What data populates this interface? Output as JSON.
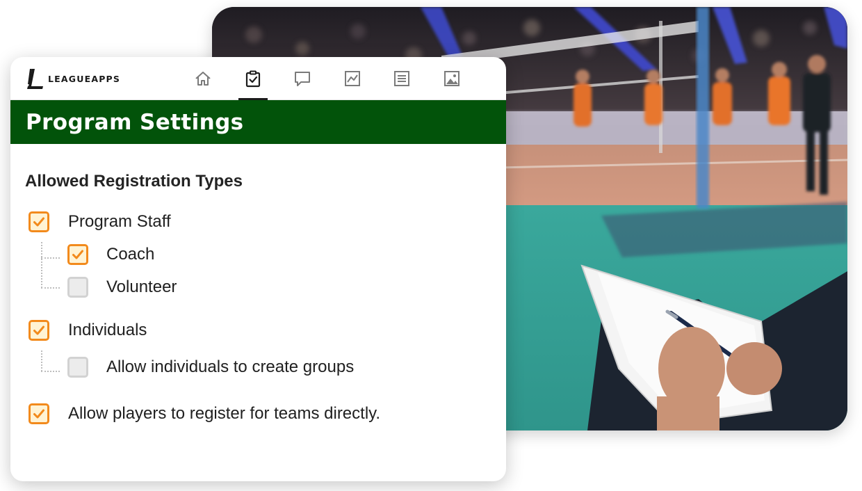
{
  "brand": {
    "logo_text": "LEAGUEAPPS",
    "accent_color": "#f28a1c",
    "header_color": "#02530a"
  },
  "nav": {
    "tabs": [
      {
        "icon": "home-icon",
        "active": false
      },
      {
        "icon": "clipboard-check-icon",
        "active": true
      },
      {
        "icon": "chat-bubble-icon",
        "active": false
      },
      {
        "icon": "chart-icon",
        "active": false
      },
      {
        "icon": "list-icon",
        "active": false
      },
      {
        "icon": "image-icon",
        "active": false
      }
    ]
  },
  "page": {
    "title": "Program Settings",
    "section_title": "Allowed Registration Types"
  },
  "options": {
    "program_staff": {
      "label": "Program Staff",
      "checked": true
    },
    "coach": {
      "label": "Coach",
      "checked": true
    },
    "volunteer": {
      "label": "Volunteer",
      "checked": false
    },
    "individuals": {
      "label": "Individuals",
      "checked": true
    },
    "allow_groups": {
      "label": "Allow individuals to create groups",
      "checked": false
    },
    "register_teams": {
      "label": "Allow players to register for teams directly.",
      "checked": true
    }
  },
  "background_image": {
    "subject": "volleyball-court-coach-clipboard-photo"
  }
}
